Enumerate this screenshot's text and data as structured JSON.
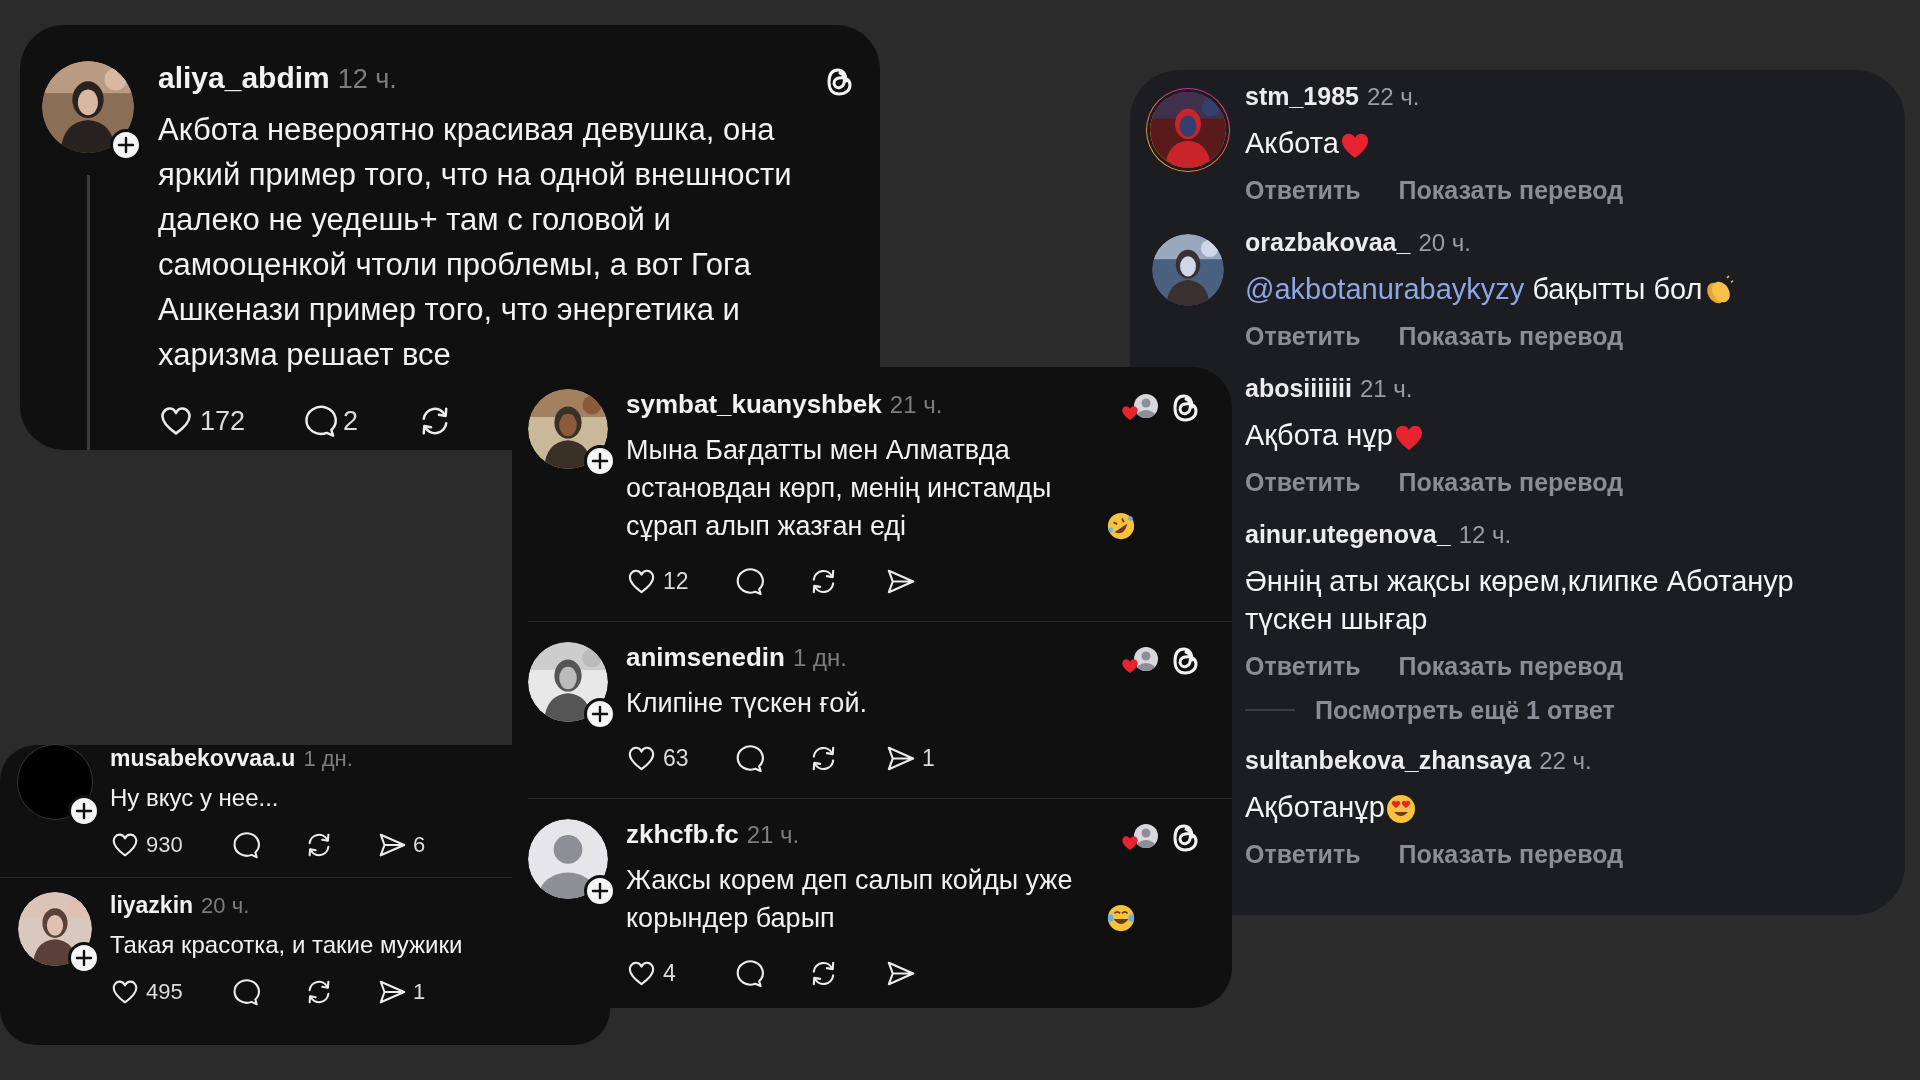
{
  "main_post": {
    "user": "aliya_abdim",
    "time": "12 ч.",
    "text": "Акбота невероятно красивая девушка, она яркий пример того, что на одной внешности далеко не уедешь+ там с головой и самооценкой чтоли проблемы, а вот Гога Ашкенази пример того, что энергетика и харизма решает все",
    "avatar": {
      "kind": "picture"
    },
    "follow": true,
    "likes": "172",
    "replies": "2"
  },
  "thread_replies": [
    {
      "user": "symbat_kuanyshbek",
      "time": "21 ч.",
      "text": "Мына Бағдатты мен Алматвда остановдан көрп, менің инстамды сұрап алып жазған еді",
      "emoji": {
        "kind": "rofl"
      },
      "avatar": {
        "kind": "picture"
      },
      "follow": true,
      "liked_by_author": true,
      "likes": "12"
    },
    {
      "user": "animsenedin",
      "time": "1 дн.",
      "text": "Клипіне түскен ғой.",
      "avatar": {
        "kind": "picture"
      },
      "follow": true,
      "liked_by_author": true,
      "likes": "63",
      "shares": "1"
    },
    {
      "user": "zkhcfb.fc",
      "time": "21 ч.",
      "text": "Жаксы корем деп салып койды уже корындер барып",
      "emoji": {
        "kind": "joy"
      },
      "avatar": {
        "kind": "default"
      },
      "follow": true,
      "liked_by_author": true,
      "likes": "4"
    }
  ],
  "side_replies": [
    {
      "user": "musabekovvaa.u",
      "time": "1 дн.",
      "text": "Ну вкус у нее...",
      "avatar": {
        "kind": "blank"
      },
      "follow": true,
      "likes": "930",
      "shares": "6"
    },
    {
      "user": "liyazkin",
      "time": "20 ч.",
      "text": "Такая красотка, и такие мужики",
      "avatar": {
        "kind": "picture"
      },
      "follow": true,
      "likes": "495",
      "shares": "1"
    }
  ],
  "comments": [
    {
      "user": "stm_1985",
      "time": "22 ч.",
      "text": "Акбота",
      "emoji": {
        "kind": "heart"
      },
      "avatar": {
        "kind": "picture"
      },
      "story_ring": true,
      "actions": [
        "Ответить",
        "Показать перевод"
      ]
    },
    {
      "user": "orazbakovaa_",
      "time": "20 ч.",
      "mention": "@akbotanurabaykyzy",
      "text": "бақытты бол",
      "emoji": {
        "kind": "clap"
      },
      "avatar": {
        "kind": "picture"
      },
      "story_ring": false,
      "actions": [
        "Ответить",
        "Показать перевод"
      ]
    },
    {
      "user": "abosiiiiiii",
      "time": "21 ч.",
      "text": "Ақбота нұр",
      "emoji": {
        "kind": "heart"
      },
      "avatar": {
        "kind": "none"
      },
      "story_ring": false,
      "actions": [
        "Ответить",
        "Показать перевод"
      ]
    },
    {
      "user": "ainur.utegenova_",
      "time": "12 ч.",
      "text": "Әннің аты жақсы көрем,клипке Аботанур түскен шығар",
      "avatar": {
        "kind": "none"
      },
      "story_ring": false,
      "actions": [
        "Ответить",
        "Показать перевод"
      ],
      "more_replies": "Посмотреть ещё 1 ответ"
    },
    {
      "user": "sultanbekova_zhansaya",
      "time": "22 ч.",
      "text": "Ақботанұр",
      "emoji": {
        "kind": "heart-eyes"
      },
      "avatar": {
        "kind": "none"
      },
      "story_ring": false,
      "actions": [
        "Ответить",
        "Показать перевод"
      ]
    }
  ]
}
